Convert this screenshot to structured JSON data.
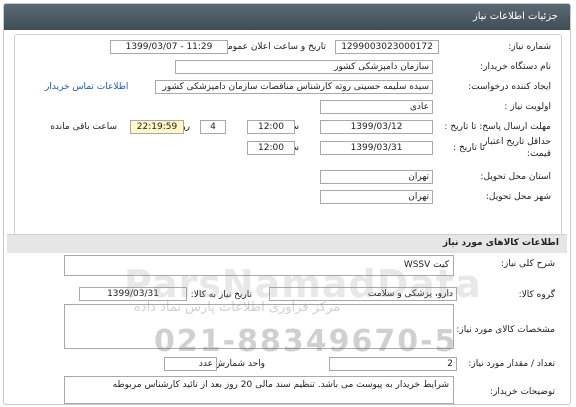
{
  "header": {
    "title": "جزئیات اطلاعات نیاز"
  },
  "details": {
    "need_number_label": "شماره نیاز:",
    "need_number": "1299003023000172",
    "announce_label": "تاریخ و ساعت اعلان عمومی:",
    "announce_value": "1399/03/07 - 11:29",
    "buyer_org_label": "نام دستگاه خریدار:",
    "buyer_org": "سازمان دامپزشکی کشور",
    "creator_label": "ایجاد کننده درخواست:",
    "creator": "سیده سلیمه  حسینی روته کارشناس مناقصات سازمان دامپزشکی کشور",
    "contact_link": "اطلاعات تماس خریدار",
    "priority_label": "اولویت نیاز :",
    "priority": "عادی",
    "send_deadline_label": "مهلت ارسال پاسخ: تا تاریخ :",
    "send_deadline_date": "1399/03/12",
    "time_label": "ساعت",
    "send_deadline_time": "12:00",
    "days_value": "4",
    "days_label": "روز و",
    "remaining_time": "22:19:59",
    "remaining_label": "ساعت باقی مانده",
    "validity_label_1": "حداقل تاریخ اعتبار",
    "validity_label_2": "قیمت:",
    "validity_until_label": "تا تاریخ :",
    "validity_date": "1399/03/31",
    "validity_time_label": "ساعت",
    "validity_time": "12:00",
    "province_label": "استان محل تحویل:",
    "province": "تهران",
    "city_label": "شهر محل تحویل:",
    "city": "تهران"
  },
  "goods_section": {
    "title": "اطلاعات کالاهای مورد نیاز",
    "summary_label": "شرح کلی نیاز:",
    "summary": "کیت WSSV",
    "group_label": "گروه کالا:",
    "group": "دارو، پزشکی و سلامت",
    "need_date_label": "تاریخ نیاز به کالا:",
    "need_date": "1399/03/31",
    "specs_label": "مشخصات کالای مورد نیاز:",
    "qty_label": "تعداد / مقدار مورد نیاز:",
    "qty": "2",
    "unit_label": "واحد شمارش:",
    "unit": "عدد",
    "buyer_notes_label": "توضیحات خریدار:",
    "buyer_notes": "شرایط خریدار به پیوست می باشد. تنظیم سند مالی 20 روز بعد از تائید کارشناس مربوطه"
  },
  "watermark": {
    "brand": "ParsNamadData",
    "tagline": "مرکز فراوری اطلاعات پارس نماد داده",
    "phone": "021-88349670-5"
  }
}
